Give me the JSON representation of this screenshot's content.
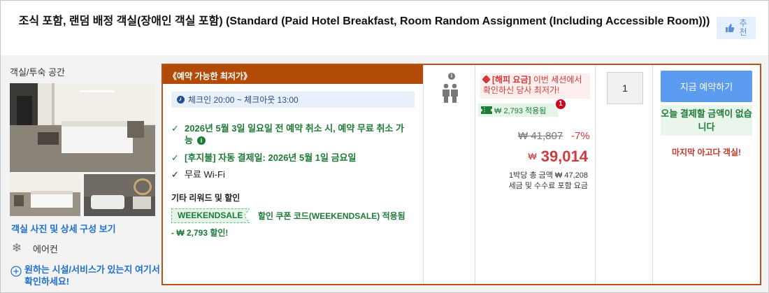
{
  "header": {
    "room_title": "조식 포함, 랜덤 배정 객실(장애인 객실 포함) (Standard (Paid Hotel Breakfast, Room Random Assignment (Including Accessible Room)))",
    "recommend_label": "추천",
    "recommend_icon": "thumbs-up-icon"
  },
  "left": {
    "space_label": "객실/투숙 공간",
    "photo_link": "객실 사진 및 상세 구성 보기",
    "amenity_aircon": "에어컨",
    "amenity_icon": "snowflake-icon",
    "facility_prompt": "원하는 시설/서비스가 있는지 여기서 확인하세요!"
  },
  "offer": {
    "lowest_header": "《예약 가능한 최저가》",
    "checkin_text": "체크인 20:00 ~ 체크아웃 13:00",
    "benefit_cancel": "2026년 5월 3일 일요일 전 예약 취소 시, 예약 무료 취소 가능",
    "benefit_autopay": "[후지불] 자동 결제일: 2026년 5월 1일 금요일",
    "benefit_wifi": "무료 Wi-Fi",
    "other_title": "기타 리워드 및 할인",
    "coupon_code": "WEEKENDSALE",
    "coupon_desc": "할인 쿠폰 코드(WEEKENDSALE) 적용됨",
    "coupon_discount": "- ₩ 2,793 할인!"
  },
  "price": {
    "happy_label": "[해피 요금]",
    "happy_text": " 이번 세션에서 확인하신 당사 최저가!",
    "applied_text": "₩ 2,793 적용됨",
    "badge_count": "1",
    "original_price": "₩ 41,807",
    "discount_pct": "-7%",
    "currency": "₩",
    "final_price": "39,014",
    "nightly_line1": "1박당 총 금액 ₩ 47,208",
    "nightly_line2": "세금 및 수수료 포함 요금"
  },
  "quantity": {
    "value": "1"
  },
  "booking": {
    "button_label": "지금 예약하기",
    "pay_today": "오늘 결제할 금액이 없습니다",
    "last_room": "마지막 아고다 객실!"
  },
  "colors": {
    "accent_orange": "#b24b07",
    "book_blue": "#5b9cf0",
    "price_red": "#d23a3a",
    "benefit_green": "#1d7a37"
  }
}
